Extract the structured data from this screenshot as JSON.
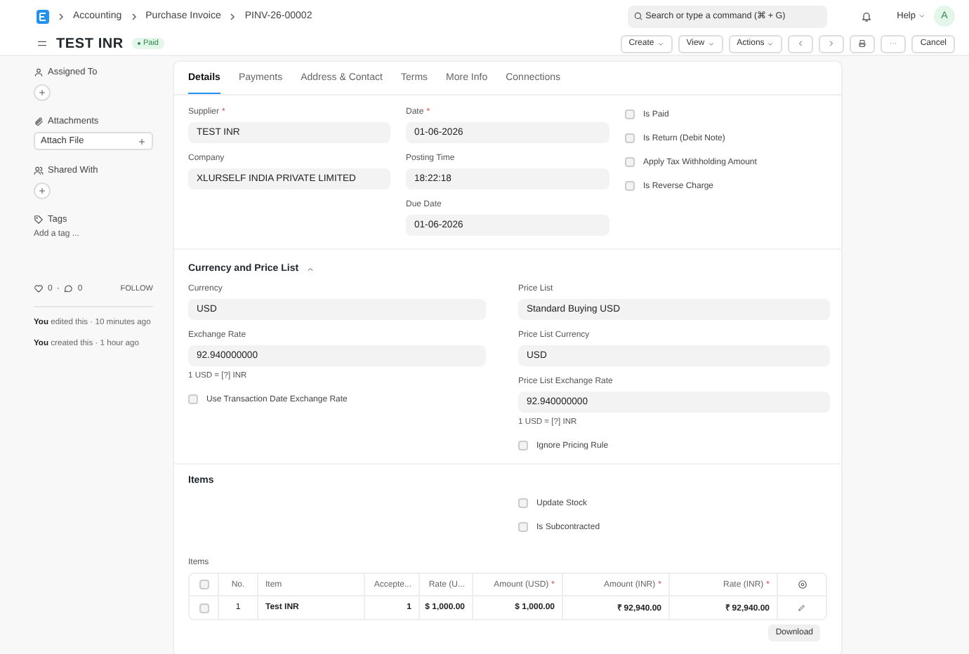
{
  "navbar": {
    "breadcrumbs": [
      "Accounting",
      "Purchase Invoice",
      "PINV-26-00002"
    ],
    "search": {
      "placeholder": "Search or type a command (⌘ + G)"
    },
    "help": "Help",
    "avatar": "A"
  },
  "header": {
    "title": "TEST INR",
    "status": "Paid",
    "buttons": [
      {
        "label": "Create",
        "kind": "dropdown"
      },
      {
        "label": "View",
        "kind": "dropdown"
      },
      {
        "label": "Actions",
        "kind": "dropdown"
      },
      {
        "kind": "prev"
      },
      {
        "kind": "next"
      },
      {
        "kind": "print"
      },
      {
        "kind": "more"
      },
      {
        "label": "Cancel",
        "kind": "plain"
      }
    ]
  },
  "sidebar": {
    "assigned_to": "Assigned To",
    "attachments": "Attachments",
    "attach_file": "Attach File",
    "shared_with": "Shared With",
    "tags": "Tags",
    "add_tag": "Add a tag ...",
    "likes": "0",
    "separator": "·",
    "comments": "0",
    "follow": "FOLLOW",
    "activity": [
      "**You** edited this · 10 minutes ago",
      "**You** created this · 1 hour ago"
    ]
  },
  "tabs": [
    {
      "label": "Details",
      "selected": true
    },
    {
      "label": "Payments",
      "selected": false
    },
    {
      "label": "Address & Contact",
      "selected": false
    },
    {
      "label": "Terms",
      "selected": false
    },
    {
      "label": "More Info",
      "selected": false
    },
    {
      "label": "Connections",
      "selected": false
    }
  ],
  "details": {
    "column_1": [
      {
        "label": "Supplier",
        "required_mark": "*",
        "value": "TEST INR"
      },
      {
        "label": "Company",
        "value": "XLURSELF INDIA PRIVATE LIMITED"
      }
    ],
    "column_2": [
      {
        "label": "Date",
        "required_mark": "*",
        "value": "01-06-2026"
      },
      {
        "label": "Posting Time",
        "value": "18:22:18"
      },
      {
        "label": "Due Date",
        "value": "01-06-2026"
      }
    ],
    "checkboxes": [
      {
        "label": "Is Paid",
        "checked": false
      },
      {
        "label": "Is Return (Debit Note)",
        "checked": false
      },
      {
        "label": "Apply Tax Withholding Amount",
        "checked": false
      },
      {
        "label": "Is Reverse Charge",
        "checked": false
      }
    ]
  },
  "currency_section": {
    "title": "Currency and Price List",
    "expanded": true,
    "left": [
      {
        "kind": "field",
        "label": "Currency",
        "value": "USD"
      },
      {
        "kind": "field",
        "label": "Exchange Rate",
        "value": "92.940000000",
        "note": "1 USD = [?] INR"
      },
      {
        "kind": "checkbox",
        "label": "Use Transaction Date Exchange Rate",
        "checked": false
      }
    ],
    "right": [
      {
        "kind": "field",
        "label": "Price List",
        "value": "Standard Buying USD"
      },
      {
        "kind": "field",
        "label": "Price List Currency",
        "value": "USD"
      },
      {
        "kind": "field",
        "label": "Price List Exchange Rate",
        "value": "92.940000000",
        "note": "1 USD = [?] INR"
      },
      {
        "kind": "checkbox",
        "label": "Ignore Pricing Rule",
        "checked": false
      }
    ]
  },
  "items_section": {
    "title": "Items",
    "checkboxes": [
      {
        "label": "Update Stock",
        "checked": false
      },
      {
        "label": "Is Subcontracted",
        "checked": false
      }
    ],
    "table_label": "Items",
    "select_all_checked": false,
    "columns": [
      {
        "label": "No."
      },
      {
        "label": "Item"
      },
      {
        "label": "Accepte..."
      },
      {
        "label": "Rate (U..."
      },
      {
        "label": "Amount (USD)",
        "required_mark": "*"
      },
      {
        "label": "Amount (INR)",
        "required_mark": "*"
      },
      {
        "label": "Rate (INR)",
        "required_mark": "*"
      }
    ],
    "rows": [
      {
        "checked": false,
        "cells": [
          "1",
          "Test INR",
          "1",
          "$ 1,000.00",
          "$ 1,000.00",
          "₹ 92,940.00",
          "₹ 92,940.00"
        ]
      }
    ],
    "download": "Download"
  }
}
